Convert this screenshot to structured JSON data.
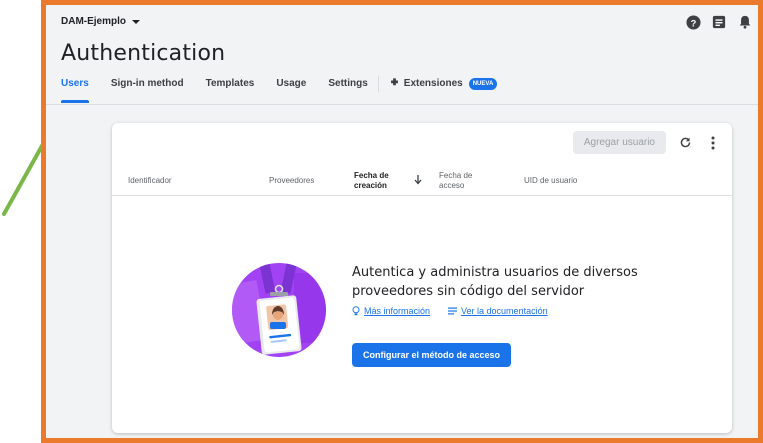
{
  "header": {
    "project": "DAM-Ejemplo",
    "title": "Authentication"
  },
  "tabs": [
    {
      "label": "Users",
      "active": true
    },
    {
      "label": "Sign-in method"
    },
    {
      "label": "Templates"
    },
    {
      "label": "Usage"
    },
    {
      "label": "Settings"
    }
  ],
  "extensions_tab": {
    "label": "Extensiones",
    "badge": "NUEVA"
  },
  "top_icons": [
    "help-icon",
    "feedback-icon",
    "notifications-icon"
  ],
  "card": {
    "add_user": "Agregar usuario",
    "columns": {
      "identifier": "Identificador",
      "providers": "Proveedores",
      "created": "Fecha de creación",
      "accessed": "Fecha de acceso",
      "uid": "UID de usuario"
    },
    "empty": {
      "message": "Autentica y administra usuarios de diversos proveedores sin código del servidor",
      "more_info": "Más información",
      "docs": "Ver la documentación",
      "cta": "Configurar el método de acceso"
    }
  },
  "colors": {
    "frame": "#ec7a2d",
    "accent": "#1a73e8",
    "arrow": "#7ab648",
    "illustration": "#a142f4"
  }
}
